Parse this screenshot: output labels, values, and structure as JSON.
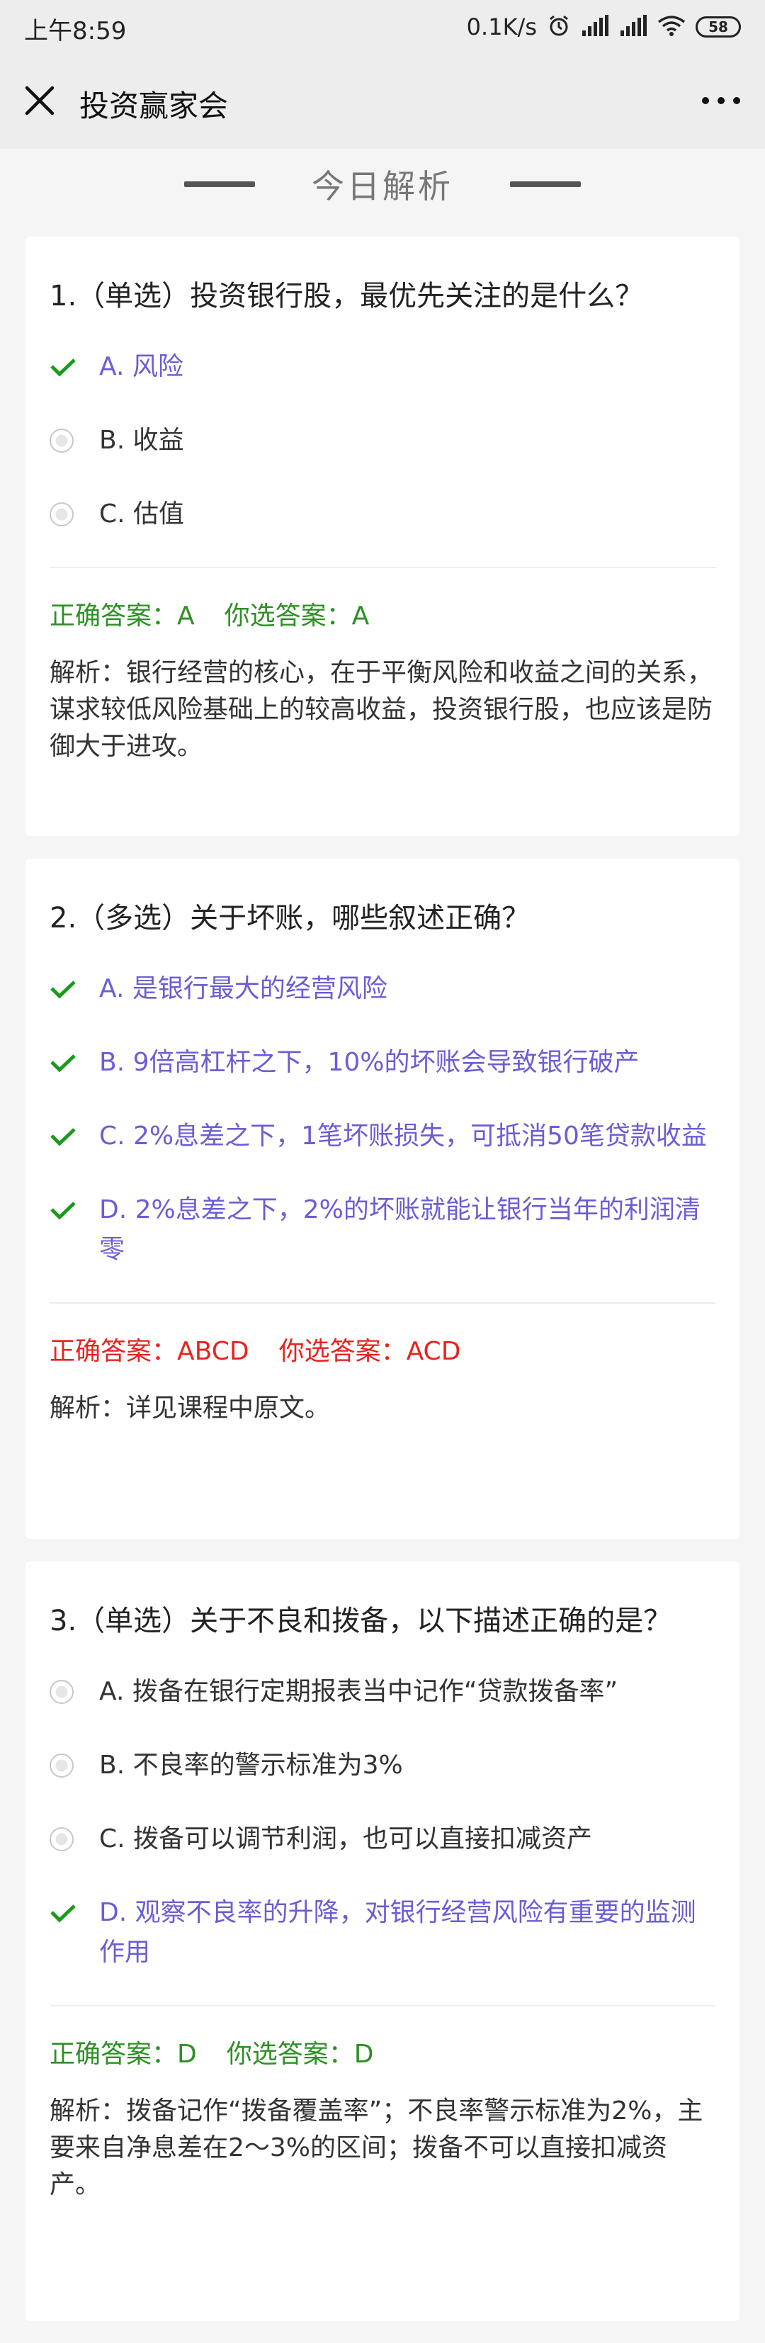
{
  "status_bar": {
    "time": "上午8:59",
    "net_speed": "0.1K/s",
    "battery": "58",
    "icons": [
      "alarm-icon",
      "signal-icon",
      "signal-icon",
      "wifi-icon",
      "battery-icon"
    ]
  },
  "nav": {
    "title": "投资赢家会",
    "close_icon": "close-icon",
    "more_icon": "more-icon"
  },
  "section": {
    "title": "今日解析"
  },
  "colors": {
    "correct_option": "#6a5ed6",
    "answer_ok": "#2e8f25",
    "answer_wrong": "#e8231e",
    "check": "#1a9a1a"
  },
  "questions": [
    {
      "text": "1.（单选）投资银行股，最优先关注的是什么？",
      "options": [
        {
          "label": "A. 风险",
          "correct": true
        },
        {
          "label": "B. 收益",
          "correct": false
        },
        {
          "label": "C. 估值",
          "correct": false
        }
      ],
      "correct_answer": "正确答案：A",
      "your_answer": "你选答案：A",
      "answer_status": "right",
      "analysis": "解析：银行经营的核心，在于平衡风险和收益之间的关系，谋求较低风险基础上的较高收益，投资银行股，也应该是防御大于进攻。"
    },
    {
      "text": "2.（多选）关于坏账，哪些叙述正确？",
      "options": [
        {
          "label": "A. 是银行最大的经营风险",
          "correct": true
        },
        {
          "label": "B. 9倍高杠杆之下，10%的坏账会导致银行破产",
          "correct": true
        },
        {
          "label": "C. 2%息差之下，1笔坏账损失，可抵消50笔贷款收益",
          "correct": true
        },
        {
          "label": "D. 2%息差之下，2%的坏账就能让银行当年的利润清零",
          "correct": true
        }
      ],
      "correct_answer": "正确答案：ABCD",
      "your_answer": "你选答案：ACD",
      "answer_status": "wrong",
      "analysis": "解析：详见课程中原文。"
    },
    {
      "text": "3.（单选）关于不良和拨备，以下描述正确的是？",
      "options": [
        {
          "label": "A. 拨备在银行定期报表当中记作“贷款拨备率”",
          "correct": false
        },
        {
          "label": "B. 不良率的警示标准为3%",
          "correct": false
        },
        {
          "label": "C. 拨备可以调节利润，也可以直接扣减资产",
          "correct": false
        },
        {
          "label": "D. 观察不良率的升降，对银行经营风险有重要的监测作用",
          "correct": true
        }
      ],
      "correct_answer": "正确答案：D",
      "your_answer": "你选答案：D",
      "answer_status": "right",
      "analysis": "解析：拨备记作“拨备覆盖率”；不良率警示标准为2%，主要来自净息差在2～3%的区间；拨备不可以直接扣减资产。"
    }
  ]
}
